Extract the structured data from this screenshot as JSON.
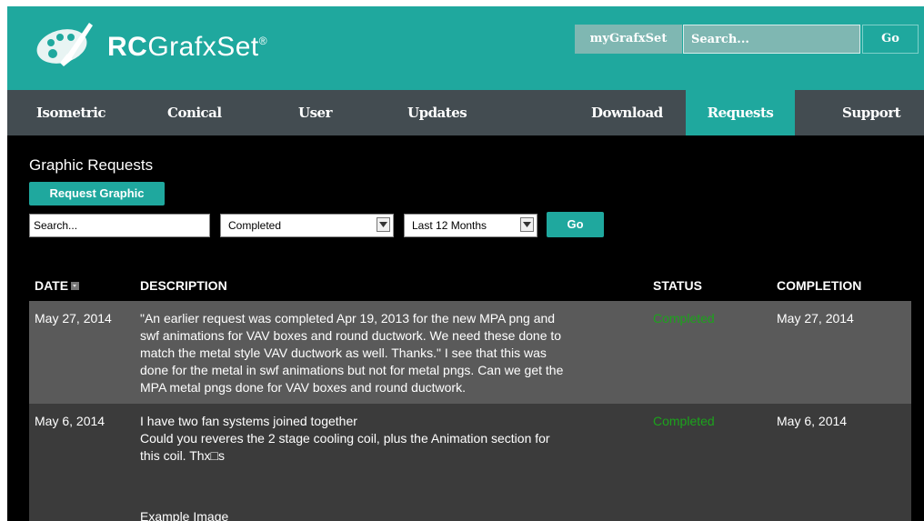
{
  "header": {
    "brand_bold": "RC",
    "brand_rest": "GrafxSet",
    "brand_mark": "®",
    "my_link": "myGrafxSet",
    "search_placeholder": "Search...",
    "go_label": "Go"
  },
  "nav": {
    "items": [
      "Isometric",
      "Conical",
      "User",
      "Updates",
      "Download",
      "Requests",
      "Support"
    ],
    "active": "Requests"
  },
  "page": {
    "title": "Graphic Requests",
    "request_button": "Request Graphic",
    "filter_search_placeholder": "Search...",
    "status_select": "Completed",
    "period_select": "Last 12 Months",
    "go_label": "Go"
  },
  "table": {
    "headers": {
      "date": "DATE",
      "description": "DESCRIPTION",
      "status": "STATUS",
      "completion": "COMPLETION"
    },
    "rows": [
      {
        "date": "May 27, 2014",
        "description": [
          "\"An earlier request was completed Apr 19, 2013 for the new MPA png and",
          "swf animations for VAV boxes and round ductwork. We need these done to",
          "match the metal style VAV ductwork as well. Thanks.\" I see that this was",
          "done for the metal in swf animations but not for metal pngs. Can we get the",
          "MPA metal pngs done for VAV boxes and round ductwork."
        ],
        "status": "Completed",
        "completion": "May 27, 2014"
      },
      {
        "date": "May 6, 2014",
        "description": [
          "I have two fan systems joined together",
          "Could you reveres the 2 stage cooling coil, plus the Animation section for",
          "this coil. Thx□s"
        ],
        "example": "Example Image",
        "status": "Completed",
        "completion": "May 6, 2014"
      }
    ]
  },
  "colors": {
    "teal": "#1fa89e",
    "nav_bg": "#434c51",
    "status_green": "#1ca31c"
  }
}
